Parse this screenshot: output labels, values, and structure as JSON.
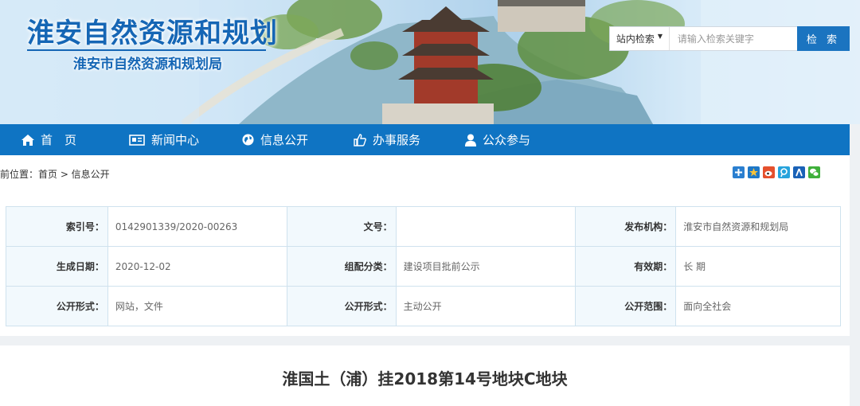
{
  "header": {
    "site_title": "淮安自然资源和规划",
    "site_subtitle": "淮安市自然资源和规划局"
  },
  "search": {
    "scope_label": "站内检索",
    "placeholder": "请输入检索关键字",
    "button_label": "检 索"
  },
  "nav": {
    "items": [
      {
        "label": "首　页",
        "icon": "home-icon"
      },
      {
        "label": "新闻中心",
        "icon": "newspaper-icon"
      },
      {
        "label": "信息公开",
        "icon": "globe-icon"
      },
      {
        "label": "办事服务",
        "icon": "thumbs-up-icon"
      },
      {
        "label": "公众参与",
        "icon": "user-icon"
      }
    ]
  },
  "breadcrumb": "当前位置：首页 > 信息公开",
  "share_icons": [
    "share-plus-icon",
    "qzone-star-icon",
    "weibo-icon",
    "tencent-icon",
    "renren-icon",
    "wechat-icon"
  ],
  "info": {
    "index_label": "索引号：",
    "index_value": "0142901339/2020-00263",
    "doc_no_label": "文号：",
    "doc_no_value": "",
    "publisher_label": "发布机构：",
    "publisher_value": "淮安市自然资源和规划局",
    "date_label": "生成日期：",
    "date_value": "2020-12-02",
    "category_label": "组配分类：",
    "category_value": "建设项目批前公示",
    "validity_label": "有效期：",
    "validity_value": "长 期",
    "form_label": "公开形式：",
    "form_value": "网站，文件",
    "form2_label": "公开形式：",
    "form2_value": "主动公开",
    "scope_label": "公开范围：",
    "scope_value": "面向全社会"
  },
  "article": {
    "title": "淮国土（浦）挂2018第14号地块C地块"
  },
  "colors": {
    "nav_bg": "#0f74c3",
    "brand_blue": "#1566b5",
    "search_button": "#1b74c0",
    "table_border": "#cfe2ee",
    "label_cell_bg": "#f2f9fd"
  }
}
